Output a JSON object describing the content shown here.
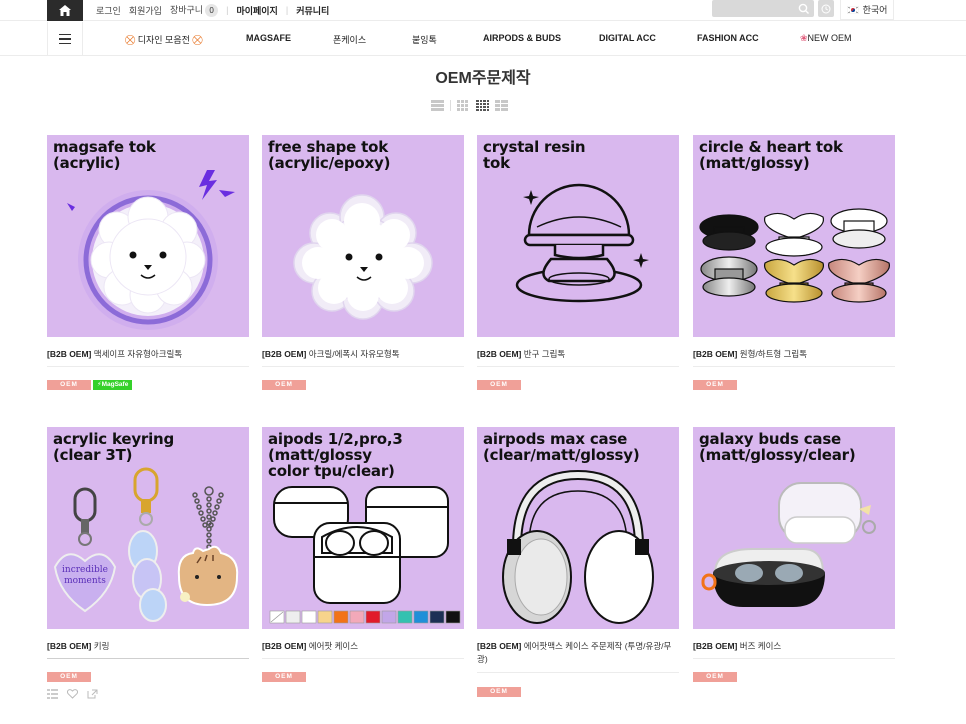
{
  "topbar": {
    "links": [
      {
        "label": "로그인"
      },
      {
        "label": "회원가입"
      },
      {
        "label": "장바구니"
      },
      {
        "label": "마이페이지"
      },
      {
        "label": "커뮤니티"
      }
    ],
    "cart_count": "0",
    "language": "한국어",
    "icons": {
      "home": "home-icon",
      "search": "search-icon",
      "recent": "clock-icon",
      "flag": "korea-flag-icon"
    }
  },
  "nav": {
    "items": [
      {
        "label": "디자인 모음전"
      },
      {
        "label": "MAGSAFE"
      },
      {
        "label": "폰케이스"
      },
      {
        "label": "붙잉톡"
      },
      {
        "label": "AIRPODS & BUDS"
      },
      {
        "label": "DIGITAL ACC"
      },
      {
        "label": "FASHION ACC"
      },
      {
        "label": "NEW OEM"
      }
    ],
    "icons": {
      "menu": "hamburger-icon",
      "gift": "gift-icon",
      "rose": "rose-icon"
    }
  },
  "page": {
    "title": "OEM주문제작"
  },
  "colors": {
    "thumb_bg": "#d9b8ee",
    "oem_badge": "#f0a098",
    "magsafe_badge": "#35d12a",
    "topbar_dark": "#2b2b2b"
  },
  "products": [
    {
      "thumb_title": "magsafe tok\n(acrylic)",
      "prefix": "[B2B OEM]",
      "name": "맥세이프 자유형아크릴톡",
      "badges": [
        "OEM",
        "MagSafe"
      ],
      "illustration": "bichon-magsafe-icon"
    },
    {
      "thumb_title": "free shape tok\n(acrylic/epoxy)",
      "prefix": "[B2B OEM]",
      "name": "아크릴/에폭시 자유모형톡",
      "badges": [
        "OEM"
      ],
      "illustration": "bichon-shape-icon"
    },
    {
      "thumb_title": "crystal resin\ntok",
      "prefix": "[B2B OEM]",
      "name": "반구 그립톡",
      "badges": [
        "OEM"
      ],
      "illustration": "crystal-tok-icon"
    },
    {
      "thumb_title": "circle & heart tok\n(matt/glossy)",
      "prefix": "[B2B OEM]",
      "name": "원형/하트형 그립톡",
      "badges": [
        "OEM"
      ],
      "illustration": "grip-toks-icon"
    },
    {
      "thumb_title": "acrylic keyring\n(clear 3T)",
      "prefix": "[B2B OEM]",
      "name": "키링",
      "badges": [
        "OEM"
      ],
      "illustration": "keyring-icon",
      "keyring_text": "incredible\nmoments"
    },
    {
      "thumb_title": "aipods 1/2,pro,3\n(matt/glossy\ncolor tpu/clear)",
      "prefix": "[B2B OEM]",
      "name": "에어팟 케이스",
      "badges": [
        "OEM"
      ],
      "illustration": "airpods-case-icon"
    },
    {
      "thumb_title": "airpods max case\n(clear/matt/glossy)",
      "prefix": "[B2B OEM]",
      "name": "에어팟맥스 케이스 주문제작 (투명/유광/무광)",
      "badges": [
        "OEM"
      ],
      "illustration": "headphones-icon"
    },
    {
      "thumb_title": "galaxy buds case\n(matt/glossy/clear)",
      "prefix": "[B2B OEM]",
      "name": "버즈 케이스",
      "badges": [
        "OEM"
      ],
      "illustration": "buds-case-icon"
    }
  ],
  "card_actions": [
    "list-icon",
    "heart-icon",
    "share-icon"
  ]
}
